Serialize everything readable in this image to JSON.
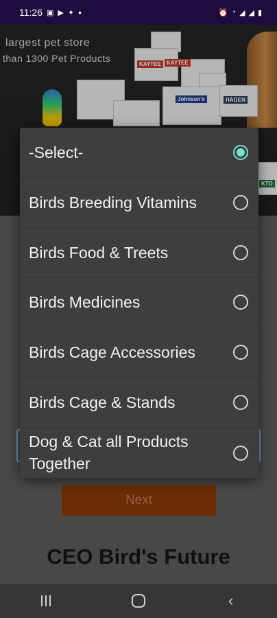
{
  "status_bar": {
    "time": "11:26",
    "dot": "•",
    "left_icons": [
      "gallery-icon",
      "youtube-icon",
      "twitter-icon"
    ],
    "right_icons": [
      "alarm-icon",
      "wifi-icon",
      "signal-icon",
      "signal-icon",
      "battery-icon"
    ]
  },
  "banner": {
    "line1": "largest  pet  store",
    "line2": "than  1300  Pet  Products",
    "brand1": "KAYTEE",
    "brand2": "KAYTEE",
    "brand3": "Johnson's",
    "brand4": "HAGEN",
    "brand5": "KTO"
  },
  "dialog": {
    "options": [
      {
        "label": "-Select-",
        "checked": true
      },
      {
        "label": "Birds Breeding Vitamins",
        "checked": false
      },
      {
        "label": "Birds Food & Treets",
        "checked": false
      },
      {
        "label": "Birds Medicines",
        "checked": false
      },
      {
        "label": "Birds Cage Accessories",
        "checked": false
      },
      {
        "label": "Birds Cage & Stands",
        "checked": false
      },
      {
        "label": "Dog & Cat all Products Together",
        "checked": false
      }
    ]
  },
  "page": {
    "next_label": "Next",
    "footer_title": "CEO Bird's Future"
  },
  "colors": {
    "accent": "#79e0cf",
    "next_button": "#8a3a05",
    "status_bar": "#1d0c3d"
  }
}
